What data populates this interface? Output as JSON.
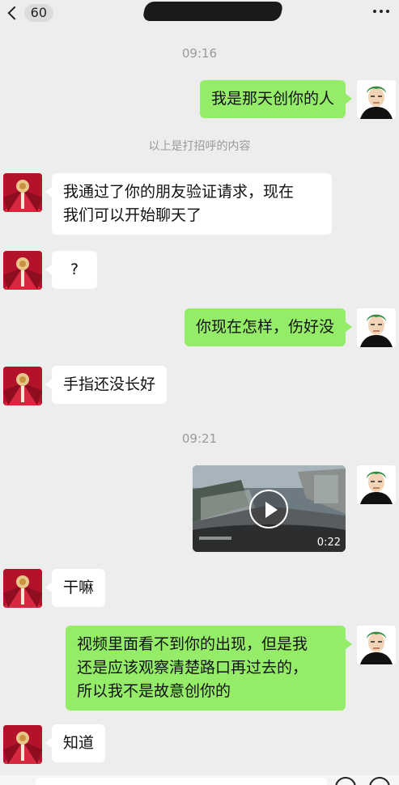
{
  "header": {
    "unread_count": "60"
  },
  "timestamps": [
    "09:16",
    "09:21"
  ],
  "system_notice": "以上是打招呼的内容",
  "messages": [
    {
      "side": "right",
      "text": "我是那天创你的人"
    },
    {
      "side": "left",
      "text": "我通过了你的朋友验证请求，现在\n我们可以开始聊天了"
    },
    {
      "side": "left",
      "text": "?"
    },
    {
      "side": "right",
      "text": "你现在怎样，伤好没"
    },
    {
      "side": "left",
      "text": "手指还没长好"
    },
    {
      "side": "right",
      "type": "video",
      "duration": "0:22"
    },
    {
      "side": "left",
      "text": "干嘛"
    },
    {
      "side": "right",
      "text": "视频里面看不到你的出现，但是我\n还是应该观察清楚路口再过去的，\n所以我不是故意创你的"
    },
    {
      "side": "left",
      "text": "知道"
    }
  ],
  "colors": {
    "background": "#ededed",
    "bubble_self": "#95ec69",
    "bubble_other": "#ffffff",
    "timestamp_text": "#9a9a9a"
  }
}
